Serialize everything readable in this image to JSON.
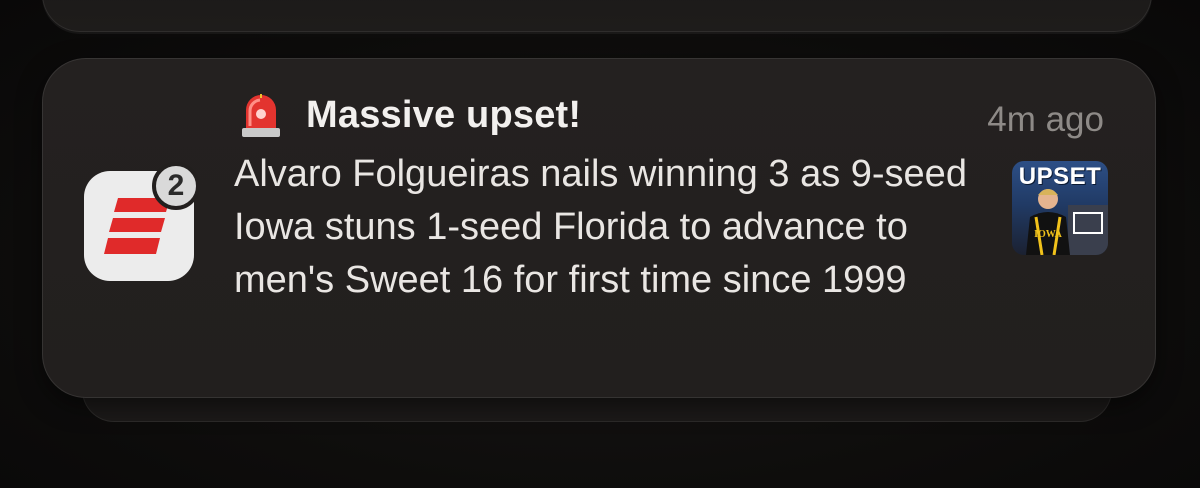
{
  "notification": {
    "app_name_icon": "espn-icon",
    "badge_count": "2",
    "title_icon": "siren-icon",
    "title": "Massive upset!",
    "timestamp": "4m ago",
    "body": "Alvaro Folgueiras nails winning 3 as 9-seed Iowa stuns 1-seed Florida to advance to men's Sweet 16 for first time since 1999",
    "thumbnail": {
      "label": "UPSET",
      "jersey_text": "IOWA"
    }
  },
  "colors": {
    "espn_red": "#e02a2a",
    "card_background": "#231f1e",
    "text_primary": "#f2f0ee",
    "text_secondary": "#8e8a87"
  }
}
